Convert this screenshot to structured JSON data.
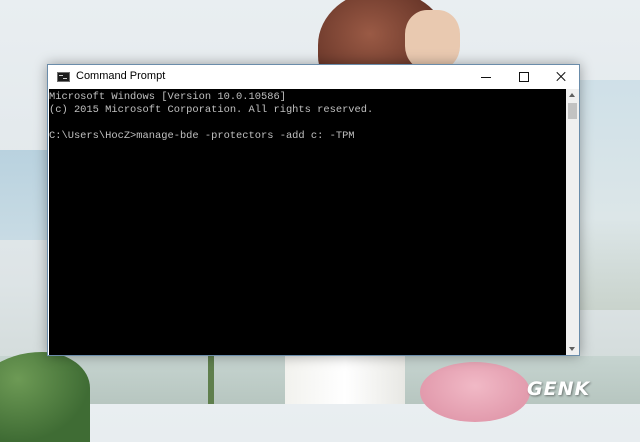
{
  "window": {
    "title": "Command Prompt",
    "icon": "console-icon",
    "controls": [
      "minimize-icon",
      "maximize-icon",
      "close-icon"
    ]
  },
  "console": {
    "lines": [
      "Microsoft Windows [Version 10.0.10586]",
      "(c) 2015 Microsoft Corporation. All rights reserved.",
      "",
      "C:\\Users\\HocZ>manage-bde -protectors -add c: -TPM"
    ],
    "text_color": "#c0c0c0",
    "background": "#000000"
  },
  "watermark": {
    "text": "GENK"
  }
}
